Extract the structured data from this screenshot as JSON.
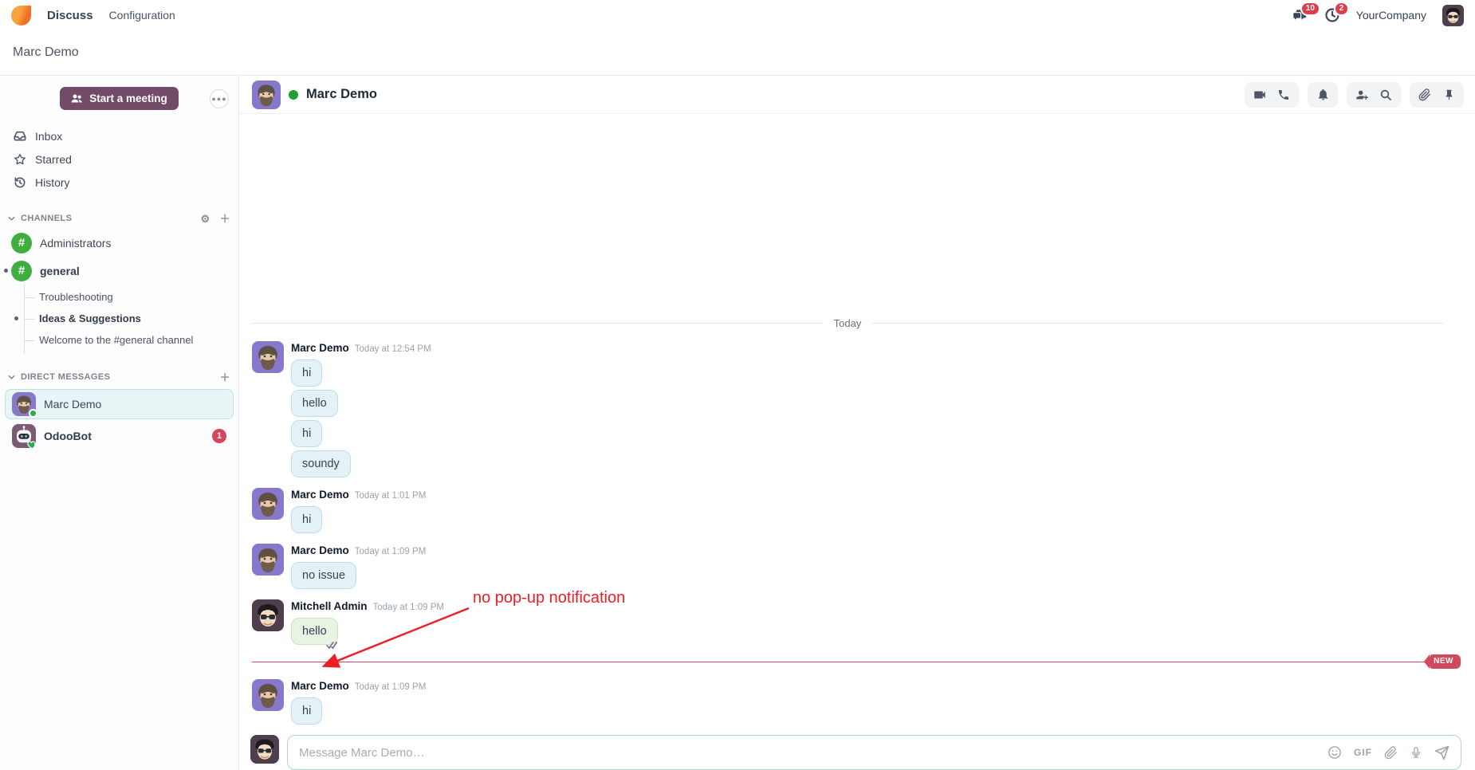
{
  "navbar": {
    "app": "Discuss",
    "menu": "Configuration",
    "company": "YourCompany",
    "messages_badge": "10",
    "activities_badge": "2",
    "icons": [
      "discuss-logo",
      "chat-bubbles-icon",
      "activity-clock-icon",
      "user-avatar"
    ]
  },
  "breadcrumb": {
    "title": "Marc Demo"
  },
  "sidebar": {
    "start_meeting_label": "Start a meeting",
    "mailboxes": [
      {
        "label": "Inbox",
        "icon": "inbox-icon"
      },
      {
        "label": "Starred",
        "icon": "star-icon"
      },
      {
        "label": "History",
        "icon": "history-icon"
      }
    ],
    "channels_header": "CHANNELS",
    "channels": [
      {
        "name": "Administrators"
      },
      {
        "name": "general",
        "unread": true
      }
    ],
    "threads": [
      {
        "name": "Troubleshooting"
      },
      {
        "name": "Ideas & Suggestions",
        "unread": true
      },
      {
        "name": "Welcome to the #general channel"
      }
    ],
    "dm_header": "DIRECT MESSAGES",
    "dms": [
      {
        "name": "Marc Demo",
        "selected": true,
        "status": "online"
      },
      {
        "name": "OdooBot",
        "badge": "1",
        "status": "bot-heart"
      }
    ]
  },
  "chat": {
    "title": "Marc Demo",
    "status": "online",
    "header_icons": [
      "video-icon",
      "phone-icon",
      "bell-icon",
      "add-user-icon",
      "search-icon",
      "paperclip-icon",
      "pin-icon"
    ],
    "date_divider": "Today",
    "new_divider_label": "NEW",
    "messages": [
      {
        "author": "Marc Demo",
        "time": "Today at 12:54 PM",
        "bubbles": [
          "hi",
          "hello",
          "hi",
          "soundy"
        ]
      },
      {
        "author": "Marc Demo",
        "time": "Today at 1:01 PM",
        "bubbles": [
          "hi"
        ]
      },
      {
        "author": "Marc Demo",
        "time": "Today at 1:09 PM",
        "bubbles": [
          "no issue"
        ]
      },
      {
        "author": "Mitchell Admin",
        "time": "Today at 1:09 PM",
        "bubbles": [
          "hello"
        ],
        "seen": true
      },
      {
        "author": "Marc Demo",
        "time": "Today at 1:09 PM",
        "bubbles": [
          "hi"
        ]
      }
    ],
    "annotation": "no pop-up notification",
    "composer": {
      "placeholder": "Message Marc Demo…",
      "gif_label": "GIF",
      "icons": [
        "emoji-smiley-icon",
        "gif-button",
        "paperclip-icon",
        "microphone-icon",
        "send-icon"
      ]
    }
  },
  "colors": {
    "primary_purple": "#714b67",
    "danger_red": "#d6455b",
    "online_green": "#2fa84f",
    "channel_green": "#3fae3f",
    "incoming_bubble": "#e4f2f7",
    "self_bubble": "#e7f3e3",
    "annotation_red": "#ee1c25"
  }
}
